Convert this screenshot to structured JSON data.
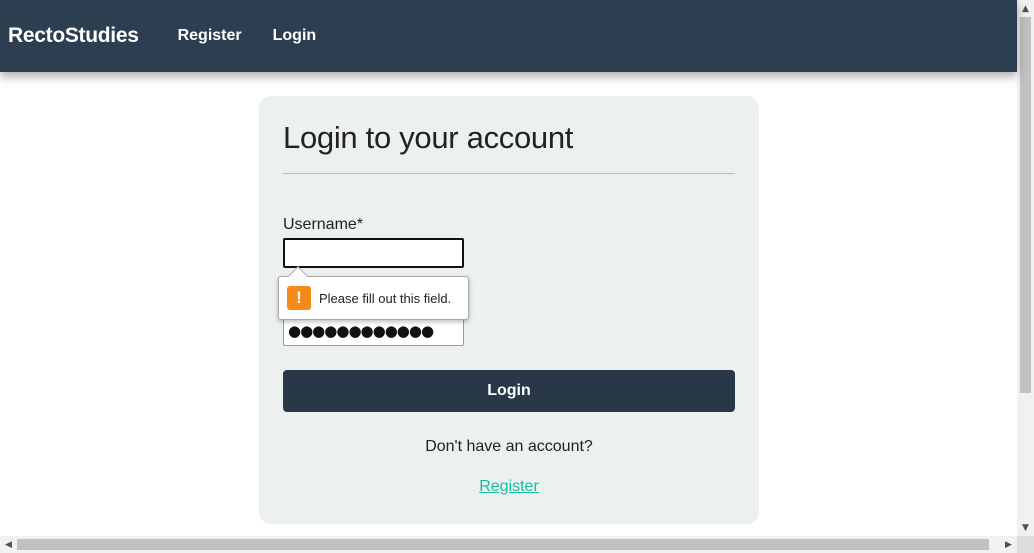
{
  "navbar": {
    "brand": "RectoStudies",
    "links": [
      {
        "label": "Register"
      },
      {
        "label": "Login"
      }
    ]
  },
  "card": {
    "title": "Login to your account",
    "username_label": "Username*",
    "username_value": "",
    "password_value": "●●●●●●●●●●●●",
    "validation_tooltip": {
      "icon": "!",
      "icon_name": "warning-icon",
      "message": "Please fill out this field."
    },
    "login_button": "Login",
    "signup_prompt": "Don't have an account?",
    "register_link": "Register"
  },
  "colors": {
    "navbar_bg": "#2c3e50",
    "card_bg": "#ecf0f1",
    "button_bg": "#283848",
    "link": "#18bc9c",
    "warning": "#f48a1a"
  },
  "scrollbars": {
    "up_arrow": "▲",
    "down_arrow": "▼",
    "left_arrow": "◀",
    "right_arrow": "▶"
  }
}
